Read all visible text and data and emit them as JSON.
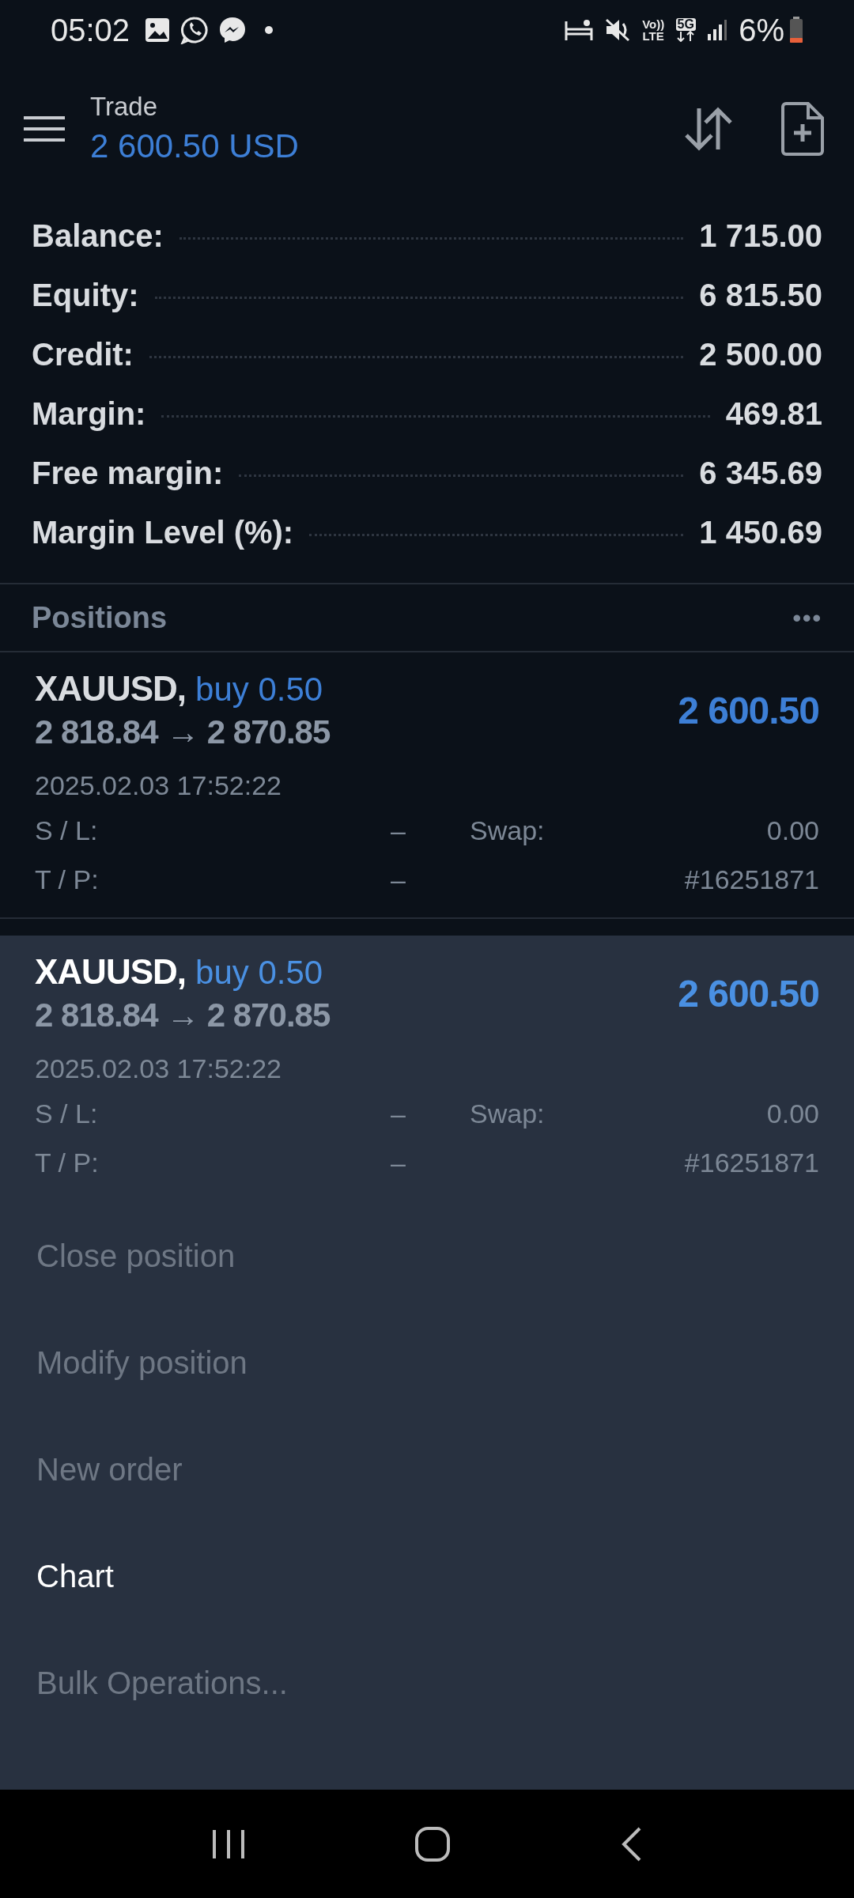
{
  "status_bar": {
    "time": "05:02",
    "volte_top": "Vo))",
    "volte_bottom": "LTE",
    "network": "5G",
    "battery": "6%"
  },
  "header": {
    "title": "Trade",
    "amount": "2 600.50 USD"
  },
  "account": [
    {
      "label": "Balance:",
      "value": "1 715.00"
    },
    {
      "label": "Equity:",
      "value": "6 815.50"
    },
    {
      "label": "Credit:",
      "value": "2 500.00"
    },
    {
      "label": "Margin:",
      "value": "469.81"
    },
    {
      "label": "Free margin:",
      "value": "6 345.69"
    },
    {
      "label": "Margin Level (%):",
      "value": "1 450.69"
    }
  ],
  "positions": {
    "title": "Positions",
    "more": "•••",
    "items": [
      {
        "symbol": "XAUUSD,",
        "side": "buy 0.50",
        "prices": "2 818.84 → 2 870.85",
        "profit": "2 600.50",
        "time": "2025.02.03 17:52:22",
        "sl_label": "S / L:",
        "sl": "–",
        "tp_label": "T / P:",
        "tp": "–",
        "swap_label": "Swap:",
        "swap": "0.00",
        "ticket": "#16251871"
      }
    ]
  },
  "context_menu": {
    "position": {
      "symbol": "XAUUSD,",
      "side": "buy 0.50",
      "prices": "2 818.84 → 2 870.85",
      "profit": "2 600.50",
      "time": "2025.02.03 17:52:22",
      "sl_label": "S / L:",
      "sl": "–",
      "tp_label": "T / P:",
      "tp": "–",
      "swap_label": "Swap:",
      "swap": "0.00",
      "ticket": "#16251871"
    },
    "items": [
      {
        "label": "Close position",
        "disabled": true
      },
      {
        "label": "Modify position",
        "disabled": true
      },
      {
        "label": "New order",
        "disabled": true
      },
      {
        "label": "Chart",
        "disabled": false
      },
      {
        "label": "Bulk Operations...",
        "disabled": true
      }
    ]
  }
}
